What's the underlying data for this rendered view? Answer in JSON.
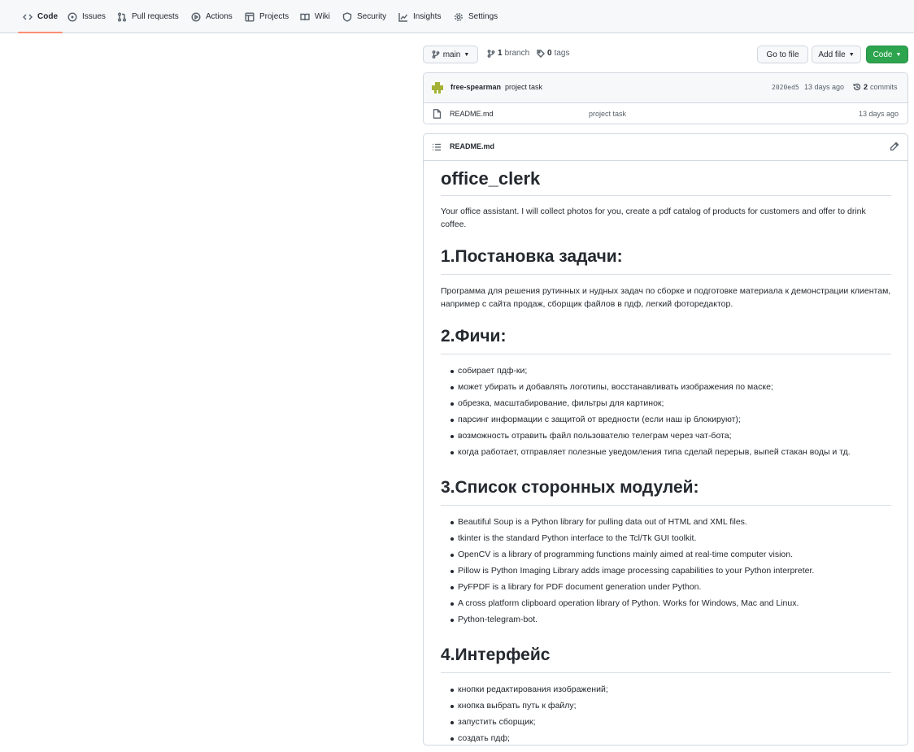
{
  "nav": {
    "tabs": [
      {
        "label": "Code",
        "icon": "code-icon"
      },
      {
        "label": "Issues",
        "icon": "issue-icon"
      },
      {
        "label": "Pull requests",
        "icon": "pull-request-icon"
      },
      {
        "label": "Actions",
        "icon": "play-icon"
      },
      {
        "label": "Projects",
        "icon": "table-icon"
      },
      {
        "label": "Wiki",
        "icon": "book-icon"
      },
      {
        "label": "Security",
        "icon": "shield-icon"
      },
      {
        "label": "Insights",
        "icon": "graph-icon"
      },
      {
        "label": "Settings",
        "icon": "gear-icon"
      }
    ],
    "active_tab": "Code"
  },
  "controls": {
    "branch_label": "main",
    "branch_count": "1",
    "branch_word": "branch",
    "tag_count": "0",
    "tag_word": "tags",
    "goto_file_label": "Go to file",
    "add_file_label": "Add file",
    "code_label": "Code"
  },
  "commit": {
    "author": "free-spearman",
    "message": "project task",
    "hash": "2020ed5",
    "age": "13 days ago",
    "count": "2",
    "count_word": "commits"
  },
  "files": [
    {
      "name": "README.md",
      "message": "project task",
      "age": "13 days ago"
    }
  ],
  "readme": {
    "header_title": "README.md",
    "title": "office_clerk",
    "intro": "Your office assistant. I will collect photos for you, create a pdf catalog of products for customers and offer to drink coffee.",
    "section1": {
      "heading": "1.Постановка задачи:",
      "text": "Программа для решения рутинных и нудных задач по сборке и подготовке материала к демонстрации клиентам, например с сайта продаж, сборщик файлов в пдф, легкий фоторедактор."
    },
    "section2": {
      "heading": "2.Фичи:",
      "items": [
        "собирает пдф-ки;",
        "может убирать и добавлять логотипы, восстанавливать изображения по маске;",
        "обрезка, масштабирование, фильтры для картинок;",
        "парсинг информации с защитой от вредности (если наш ip блокируют);",
        "возможность отравить файл пользователю телеграм через чат-бота;",
        "когда работает, отправляет полезные уведомления типа сделай перерыв, выпей стакан воды и тд."
      ]
    },
    "section3": {
      "heading": "3.Список сторонных модулей:",
      "items": [
        "Beautiful Soup is a Python library for pulling data out of HTML and XML files.",
        "tkinter is the standard Python interface to the Tcl/Tk GUI toolkit.",
        "OpenCV is a library of programming functions mainly aimed at real-time computer vision.",
        "Pillow is Python Imaging Library adds image processing capabilities to your Python interpreter.",
        "PyFPDF is a library for PDF document generation under Python.",
        "A cross platform clipboard operation library of Python. Works for Windows, Mac and Linux.",
        "Python-telegram-bot."
      ]
    },
    "section4": {
      "heading": "4.Интерфейс",
      "items": [
        "кнопки редактирования изображений;",
        "кнопка выбрать путь к файлу;",
        "запустить сборщик;",
        "создать пдф;"
      ]
    }
  },
  "colors": {
    "accent_underline": "#fd8c73",
    "code_button": "#2da44e",
    "border": "#d0d7de",
    "muted_text": "#57606a"
  }
}
